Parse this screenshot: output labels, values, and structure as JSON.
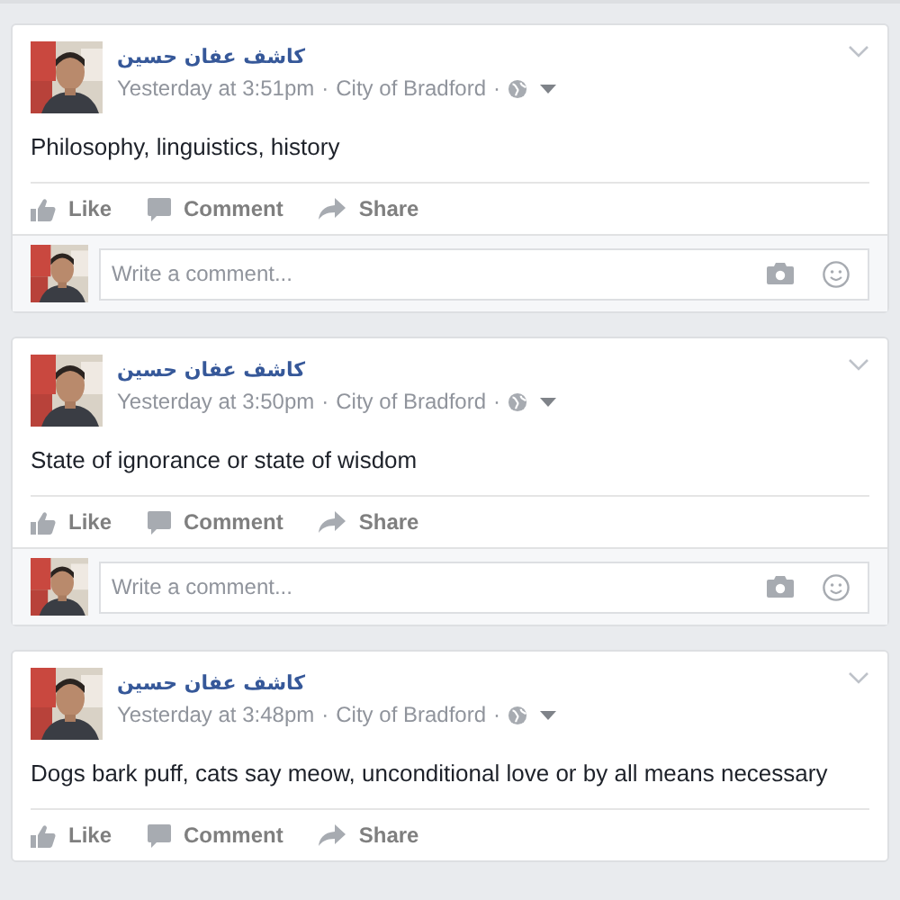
{
  "posts": [
    {
      "author": "كاشف عفان حسين",
      "time": "Yesterday at 3:51pm",
      "separators": [
        "·",
        "·"
      ],
      "location": "City of Bradford",
      "text": "Philosophy, linguistics, history",
      "actions": [
        "Like",
        "Comment",
        "Share"
      ],
      "comment_placeholder": "Write a comment..."
    },
    {
      "author": "كاشف عفان حسين",
      "time": "Yesterday at 3:50pm",
      "separators": [
        "·",
        "·"
      ],
      "location": "City of Bradford",
      "text": "State of ignorance or state of wisdom",
      "actions": [
        "Like",
        "Comment",
        "Share"
      ],
      "comment_placeholder": "Write a comment..."
    },
    {
      "author": "كاشف عفان حسين",
      "time": "Yesterday at 3:48pm",
      "separators": [
        "·",
        "·"
      ],
      "location": "City of Bradford",
      "text": "Dogs bark puff, cats say meow, unconditional love or by all means necessary",
      "actions": [
        "Like",
        "Comment",
        "Share"
      ]
    }
  ]
}
